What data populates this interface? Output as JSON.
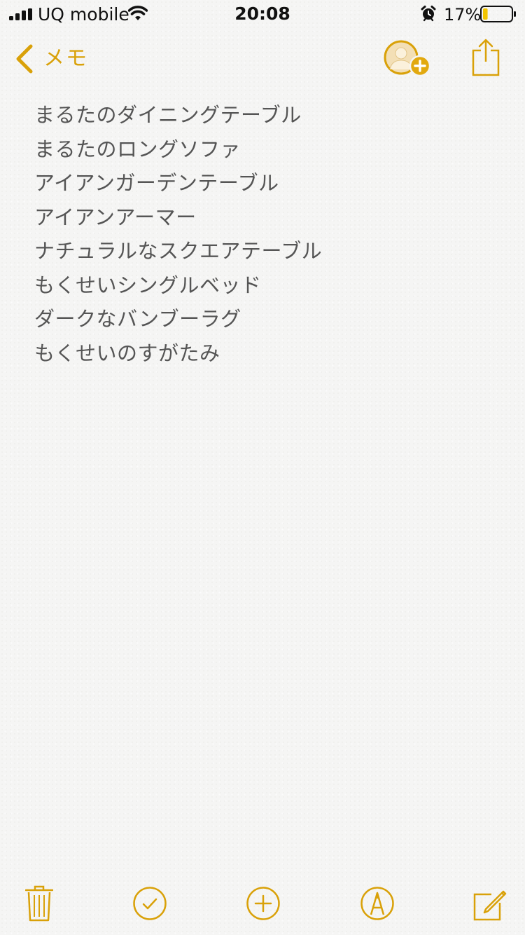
{
  "status_bar": {
    "carrier": "UQ mobile",
    "time": "20:08",
    "battery_percent": "17%",
    "battery_level": 0.17,
    "icons": [
      "signal-bars-icon",
      "wifi-icon",
      "alarm-icon",
      "battery-icon"
    ]
  },
  "nav": {
    "back_label": "メモ",
    "icons": [
      "chevron-left-icon",
      "add-person-icon",
      "share-icon"
    ]
  },
  "note": {
    "lines": [
      "まるたのダイニングテーブル",
      "まるたのロングソファ",
      "アイアンガーデンテーブル",
      "アイアンアーマー",
      "ナチュラルなスクエアテーブル",
      "もくせいシングルベッド",
      "ダークなバンブーラグ",
      "もくせいのすがたみ"
    ]
  },
  "toolbar": {
    "icons": [
      "trash-icon",
      "checklist-icon",
      "plus-icon",
      "markup-icon",
      "compose-icon"
    ]
  },
  "colors": {
    "accent": "#d9a109",
    "text": "#555555",
    "background": "#f5f5f4",
    "battery_fill": "#f2c500"
  }
}
